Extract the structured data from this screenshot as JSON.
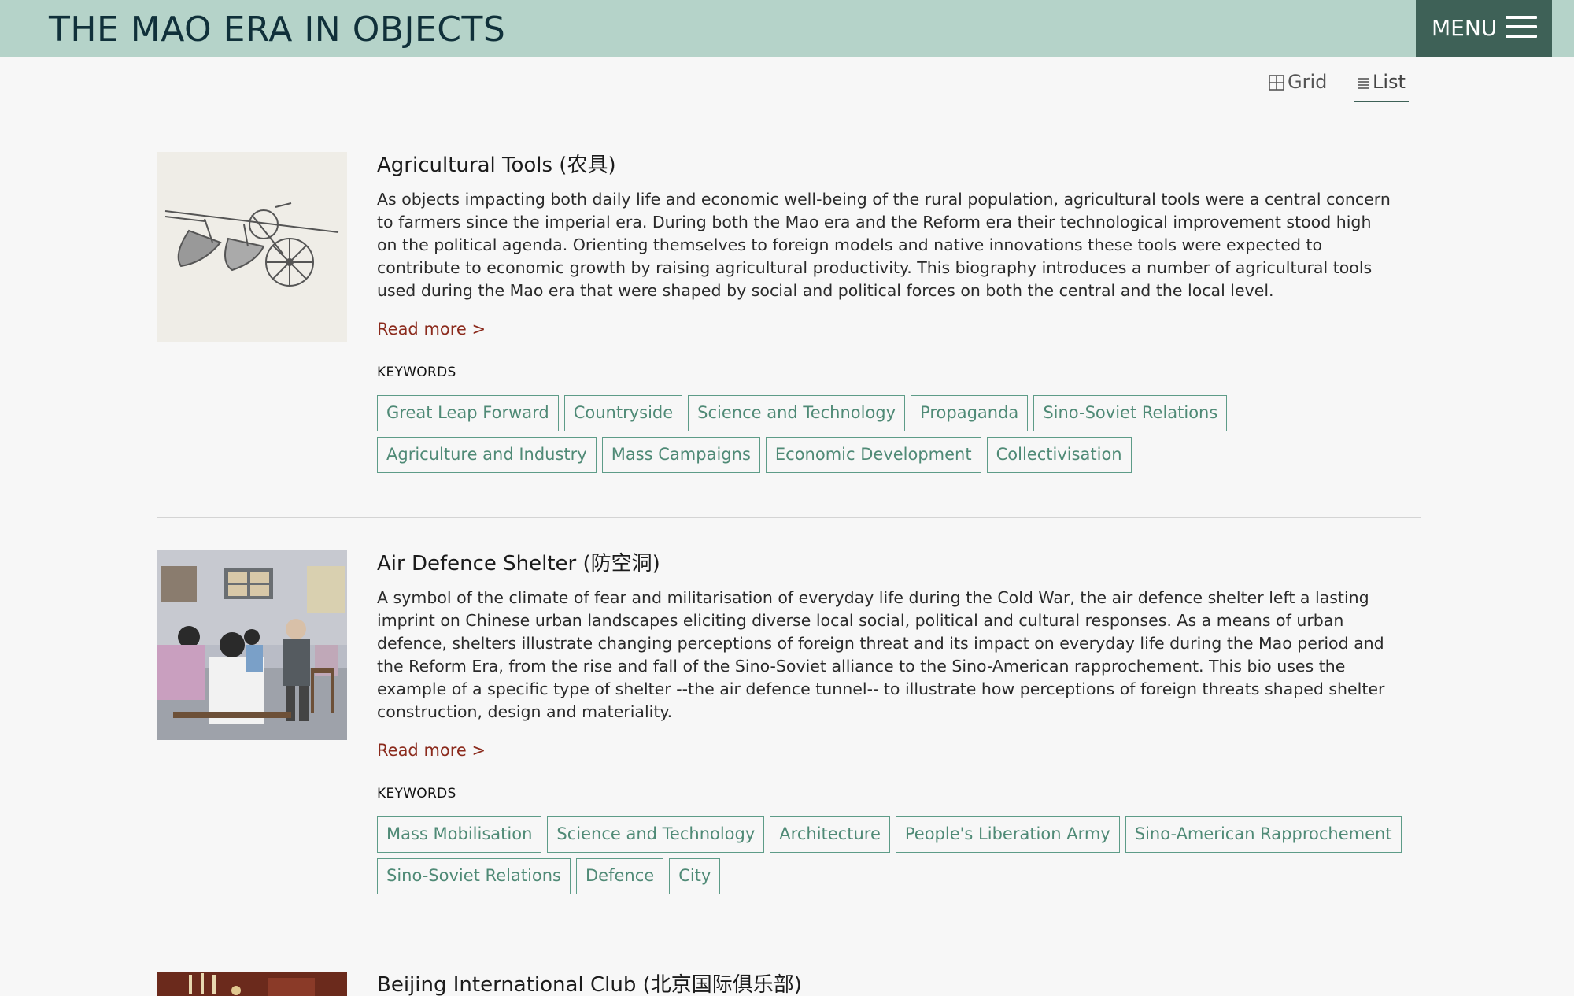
{
  "header": {
    "site_title": "THE MAO ERA IN OBJECTS",
    "menu_label": "MENU",
    "bg_color": "#b5d3c9",
    "menu_bg_color": "#3e6157"
  },
  "view": {
    "grid_label": "Grid",
    "list_label": "List",
    "active": "List"
  },
  "entries": [
    {
      "title": "Agricultural Tools (农具)",
      "description": "As objects impacting both daily life and economic well-being of the rural population, agricultural tools were a central concern to farmers since the imperial era. During both the Mao era and the Reform era their technological improvement stood high on the political agenda. Orienting themselves to foreign models and native innovations these tools were expected to contribute to economic growth by raising agricultural productivity. This biography introduces a number of agricultural tools used during the Mao era that were shaped by social and political forces on both the central and the local level.",
      "read_more": "Read more >",
      "keywords_title": "KEYWORDS",
      "keywords_row1": [
        "Great Leap Forward",
        "Countryside",
        "Science and Technology",
        "Propaganda",
        "Sino-Soviet Relations"
      ],
      "keywords_row2": [
        "Agriculture and Industry",
        "Mass Campaigns",
        "Economic Development",
        "Collectivisation"
      ]
    },
    {
      "title": "Air Defence Shelter (防空洞)",
      "description": "A symbol of the climate of fear and militarisation of everyday life during the Cold War, the air defence shelter left a lasting imprint on Chinese urban landscapes eliciting diverse local social, political and cultural responses. As a means of urban defence, shelters illustrate changing perceptions of foreign threat and its impact on everyday life during the Mao period and the Reform Era, from the rise and fall of the Sino-Soviet alliance to the Sino-American rapprochement. This bio uses the example of a specific type of shelter --the air defence tunnel-- to illustrate how perceptions of foreign threats shaped shelter construction, design and materiality.",
      "read_more": "Read more >",
      "keywords_title": "KEYWORDS",
      "keywords_row1": [
        "Mass Mobilisation",
        "Science and Technology",
        "Architecture",
        "People's Liberation Army",
        "Sino-American Rapprochement"
      ],
      "keywords_row2": [
        "Sino-Soviet Relations",
        "Defence",
        "City"
      ]
    },
    {
      "title": "Beijing International Club (北京国际俱乐部)"
    }
  ],
  "colors": {
    "read_more": "#8b2a1c",
    "keyword_border": "#5e9c88",
    "keyword_text": "#4f8a76"
  }
}
